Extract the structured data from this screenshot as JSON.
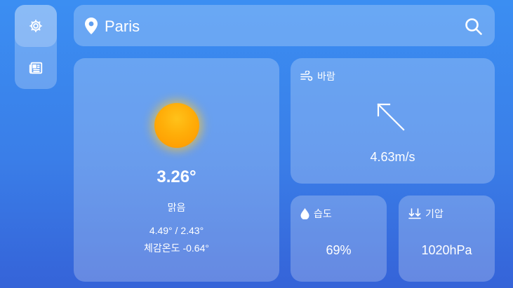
{
  "nav": {
    "items": [
      {
        "icon": "settings-icon",
        "active": true
      },
      {
        "icon": "news-icon",
        "active": false
      }
    ]
  },
  "search": {
    "value": "Paris",
    "icon": "search-icon",
    "location_icon": "location-pin-icon"
  },
  "weather": {
    "icon": "sun-icon",
    "temperature": "3.26°",
    "condition": "맑음",
    "min_max": "4.49° / 2.43°",
    "feels_like": "체감온도 -0.64°"
  },
  "wind": {
    "label": "바람",
    "icon": "wind-icon",
    "direction_icon": "arrow-up-left-icon",
    "speed": "4.63m/s"
  },
  "humidity": {
    "label": "습도",
    "icon": "droplet-icon",
    "value": "69%"
  },
  "pressure": {
    "label": "기압",
    "icon": "pressure-down-icon",
    "value": "1020hPa"
  },
  "colors": {
    "background_top": "#3b8ef2",
    "background_bottom": "#3563d8",
    "sun": "#ffad08"
  }
}
